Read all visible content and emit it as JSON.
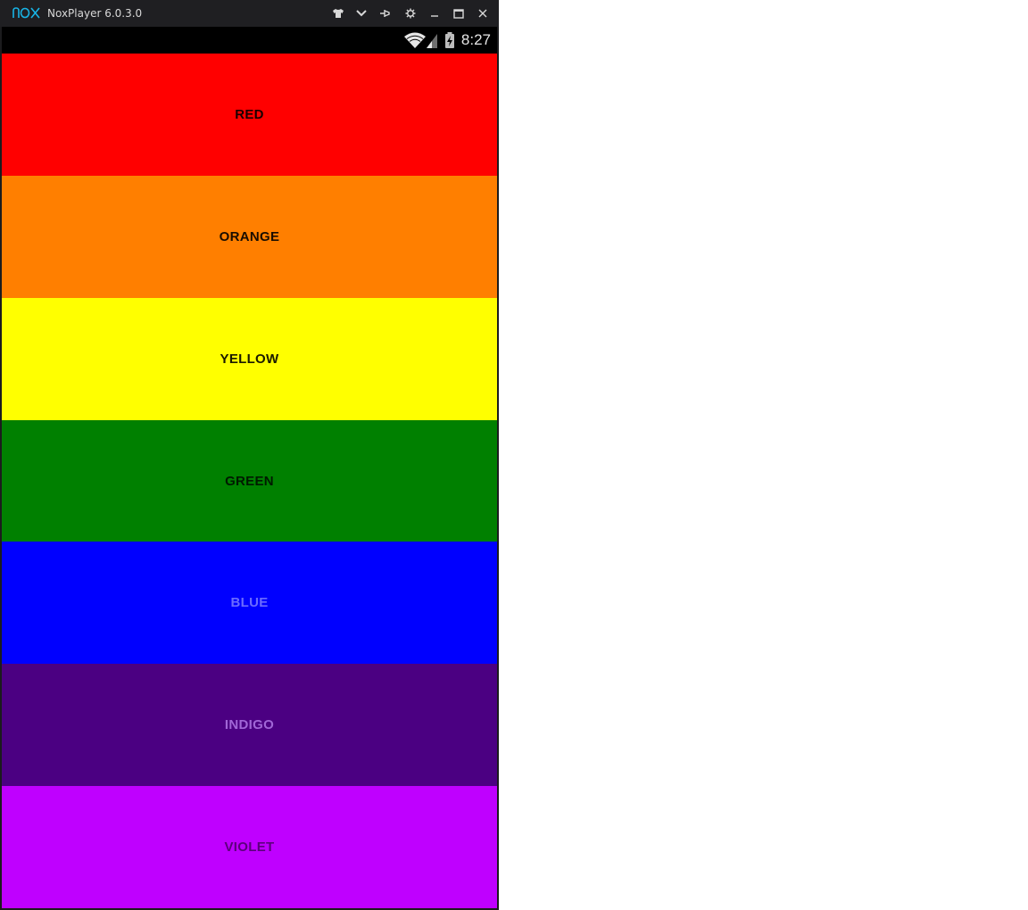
{
  "window": {
    "title": "NoxPlayer 6.0.3.0",
    "logo_icon": "nox-logo-icon",
    "controls": [
      {
        "name": "skin-button",
        "icon": "tshirt-icon"
      },
      {
        "name": "menu-button",
        "icon": "chevron-down-icon"
      },
      {
        "name": "pin-button",
        "icon": "pin-icon"
      },
      {
        "name": "settings-button",
        "icon": "gear-icon"
      },
      {
        "name": "minimize-button",
        "icon": "minimize-icon"
      },
      {
        "name": "maximize-button",
        "icon": "maximize-icon"
      },
      {
        "name": "close-button",
        "icon": "close-icon"
      }
    ]
  },
  "statusbar": {
    "time": "8:27",
    "icons": [
      "wifi-icon",
      "signal-icon",
      "battery-charging-icon"
    ]
  },
  "bands": [
    {
      "label": "RED",
      "bg": "#ff0000",
      "fg": "#1a0000"
    },
    {
      "label": "ORANGE",
      "bg": "#ff7f00",
      "fg": "#1a0d00"
    },
    {
      "label": "YELLOW",
      "bg": "#ffff00",
      "fg": "#1a1a00"
    },
    {
      "label": "GREEN",
      "bg": "#008000",
      "fg": "#001a00"
    },
    {
      "label": "BLUE",
      "bg": "#0000ff",
      "fg": "#6b6bff"
    },
    {
      "label": "INDIGO",
      "bg": "#4b0082",
      "fg": "#a066d6"
    },
    {
      "label": "VIOLET",
      "bg": "#bf00ff",
      "fg": "#5c007d"
    }
  ]
}
